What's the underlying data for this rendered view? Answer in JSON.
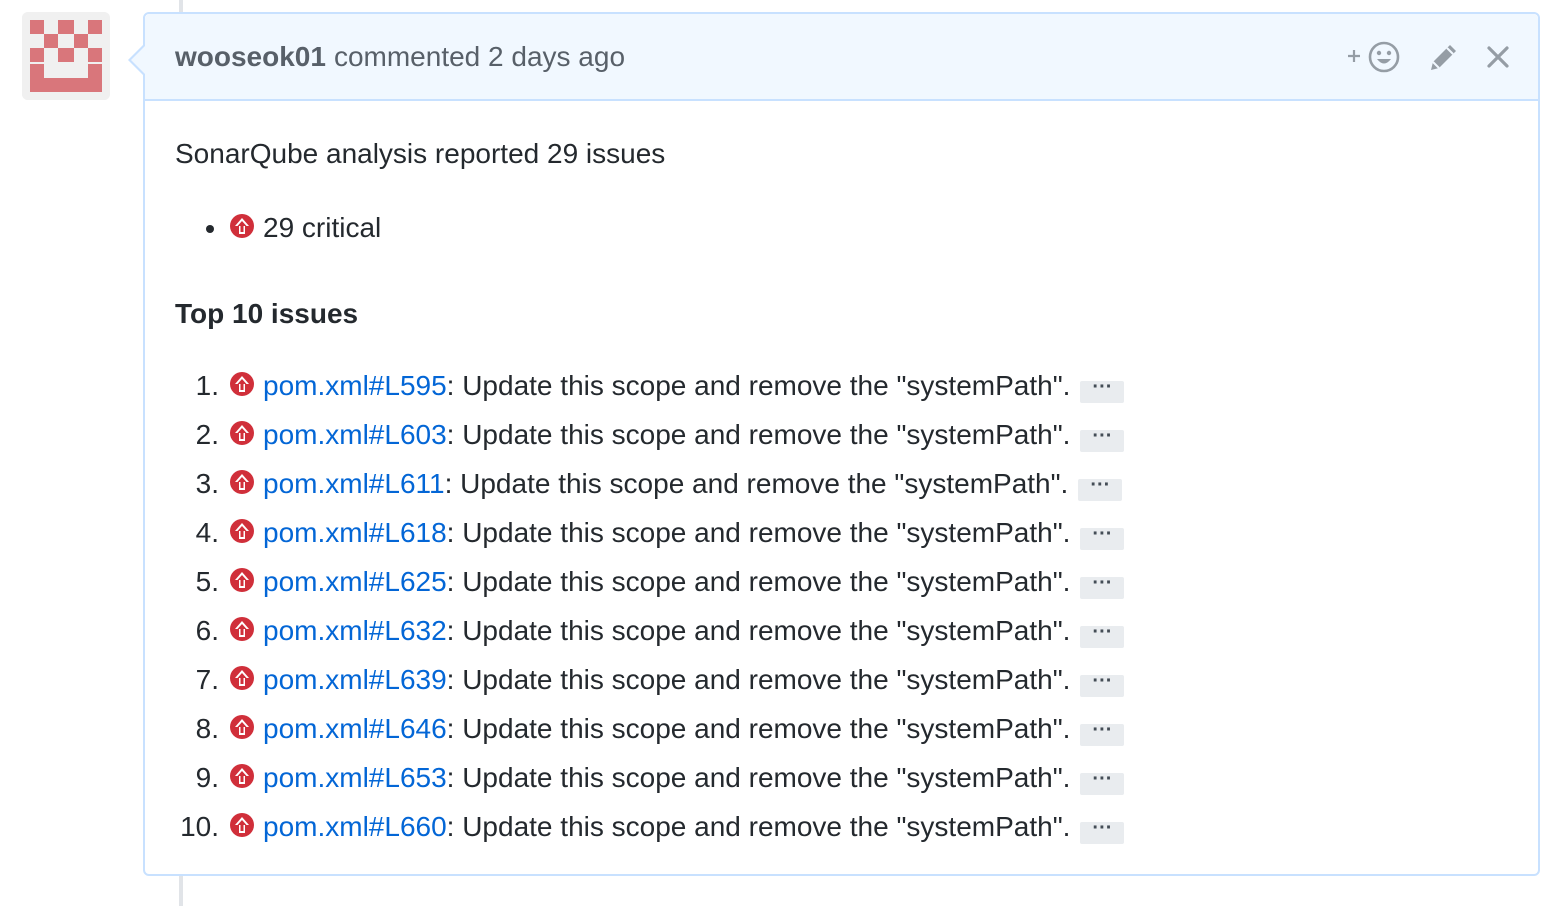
{
  "comment": {
    "author": "wooseok01",
    "action_text": "commented 2 days ago",
    "actions": {
      "reaction_icon": "add-reaction-smiley-icon",
      "edit_icon": "pencil-icon",
      "delete_icon": "close-icon"
    }
  },
  "body": {
    "summary": "SonarQube analysis reported 29 issues",
    "severity_counts": [
      {
        "icon": "critical-severity-icon",
        "label": "29 critical"
      }
    ],
    "top_heading": "Top 10 issues",
    "ellipsis_label": "···",
    "issues": [
      {
        "num": "1.",
        "link": "pom.xml#L595",
        "message": ": Update this scope and remove the \"systemPath\"."
      },
      {
        "num": "2.",
        "link": "pom.xml#L603",
        "message": ": Update this scope and remove the \"systemPath\"."
      },
      {
        "num": "3.",
        "link": "pom.xml#L611",
        "message": ": Update this scope and remove the \"systemPath\"."
      },
      {
        "num": "4.",
        "link": "pom.xml#L618",
        "message": ": Update this scope and remove the \"systemPath\"."
      },
      {
        "num": "5.",
        "link": "pom.xml#L625",
        "message": ": Update this scope and remove the \"systemPath\"."
      },
      {
        "num": "6.",
        "link": "pom.xml#L632",
        "message": ": Update this scope and remove the \"systemPath\"."
      },
      {
        "num": "7.",
        "link": "pom.xml#L639",
        "message": ": Update this scope and remove the \"systemPath\"."
      },
      {
        "num": "8.",
        "link": "pom.xml#L646",
        "message": ": Update this scope and remove the \"systemPath\"."
      },
      {
        "num": "9.",
        "link": "pom.xml#L653",
        "message": ": Update this scope and remove the \"systemPath\"."
      },
      {
        "num": "10.",
        "link": "pom.xml#L660",
        "message": ": Update this scope and remove the \"systemPath\"."
      }
    ]
  },
  "colors": {
    "header_bg": "#f1f8ff",
    "border": "#c8e1ff",
    "link": "#0366d6",
    "critical": "#d02f3a",
    "avatar": "#d9767b"
  }
}
